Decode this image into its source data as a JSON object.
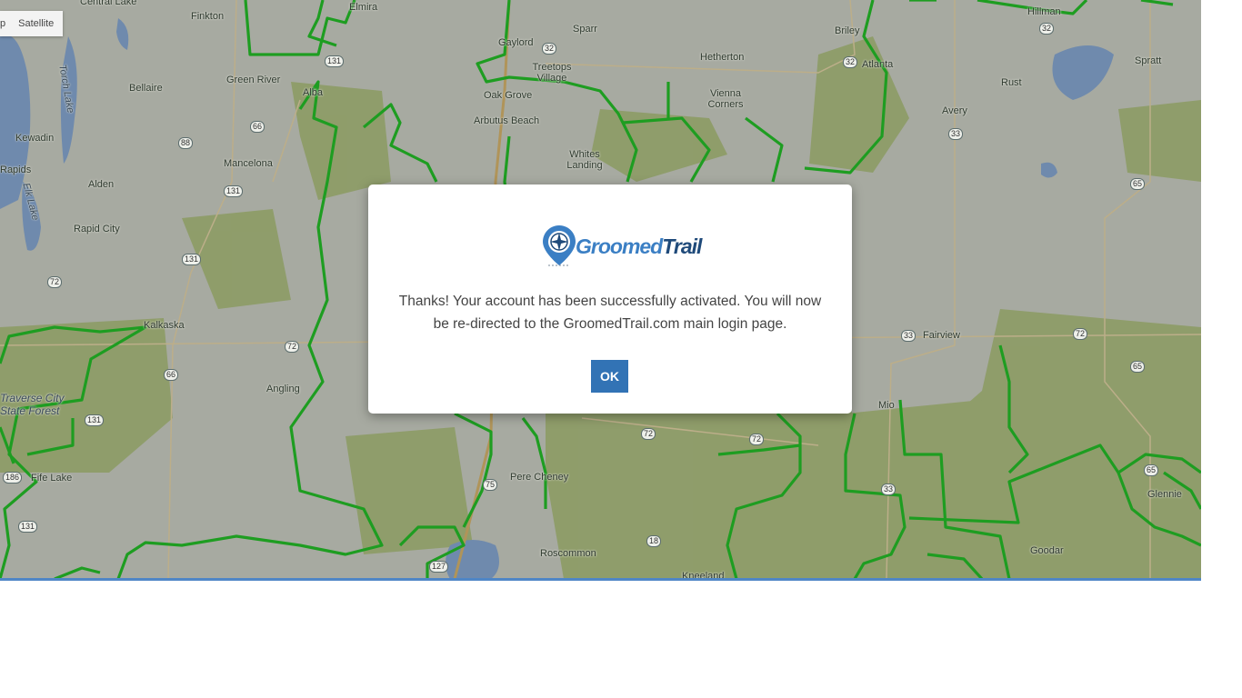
{
  "map": {
    "type_control": {
      "map_label_partial": "p",
      "satellite_label": "Satellite"
    },
    "labels": [
      {
        "text": "Central Lake"
      },
      {
        "text": "Elmira"
      },
      {
        "text": "Hillman"
      },
      {
        "text": "Finkton"
      },
      {
        "text": "Gaylord"
      },
      {
        "text": "Sparr"
      },
      {
        "text": "Briley"
      },
      {
        "text": "Spratt"
      },
      {
        "text": "Treetops Village"
      },
      {
        "text": "Hetherton"
      },
      {
        "text": "Atlanta"
      },
      {
        "text": "Green River"
      },
      {
        "text": "Bellaire"
      },
      {
        "text": "Alba"
      },
      {
        "text": "Oak Grove"
      },
      {
        "text": "Vienna Corners"
      },
      {
        "text": "Rust"
      },
      {
        "text": "Torch Lake",
        "italic": true
      },
      {
        "text": "Arbutus Beach"
      },
      {
        "text": "Avery"
      },
      {
        "text": "Kewadin"
      },
      {
        "text": "Whites Landing"
      },
      {
        "text": "Mancelona"
      },
      {
        "text": "Rapids"
      },
      {
        "text": "Alden"
      },
      {
        "text": "Elk Lake",
        "italic": true
      },
      {
        "text": "Rapid City"
      },
      {
        "text": "Kalkaska"
      },
      {
        "text": "Fairview"
      },
      {
        "text": "Angling"
      },
      {
        "text": "Traverse City State Forest",
        "italic": true
      },
      {
        "text": "Mio"
      },
      {
        "text": "Fife Lake"
      },
      {
        "text": "Pere Cheney"
      },
      {
        "text": "Glennie"
      },
      {
        "text": "Roscommon"
      },
      {
        "text": "Goodar"
      },
      {
        "text": "Kneeland"
      }
    ],
    "shields": [
      {
        "text": "32"
      },
      {
        "text": "32"
      },
      {
        "text": "32"
      },
      {
        "text": "131"
      },
      {
        "text": "66"
      },
      {
        "text": "88"
      },
      {
        "text": "33"
      },
      {
        "text": "131"
      },
      {
        "text": "65"
      },
      {
        "text": "131"
      },
      {
        "text": "72"
      },
      {
        "text": "72"
      },
      {
        "text": "33"
      },
      {
        "text": "72"
      },
      {
        "text": "66"
      },
      {
        "text": "65"
      },
      {
        "text": "131"
      },
      {
        "text": "72"
      },
      {
        "text": "72"
      },
      {
        "text": "186"
      },
      {
        "text": "75"
      },
      {
        "text": "33"
      },
      {
        "text": "65"
      },
      {
        "text": "131"
      },
      {
        "text": "18"
      },
      {
        "text": "127"
      }
    ]
  },
  "modal": {
    "logo": {
      "groomed": "Groomed",
      "trail": "Trail"
    },
    "message": "Thanks! Your account has been successfully activated. You will now be re-directed to the GroomedTrail.com main login page.",
    "ok_label": "OK"
  },
  "colors": {
    "trail_green": "#18b21c",
    "forest_green": "#9cb06a",
    "water_blue": "#7a9cc6",
    "button_blue": "#3273b5",
    "bottom_bar": "#4f86c6"
  }
}
